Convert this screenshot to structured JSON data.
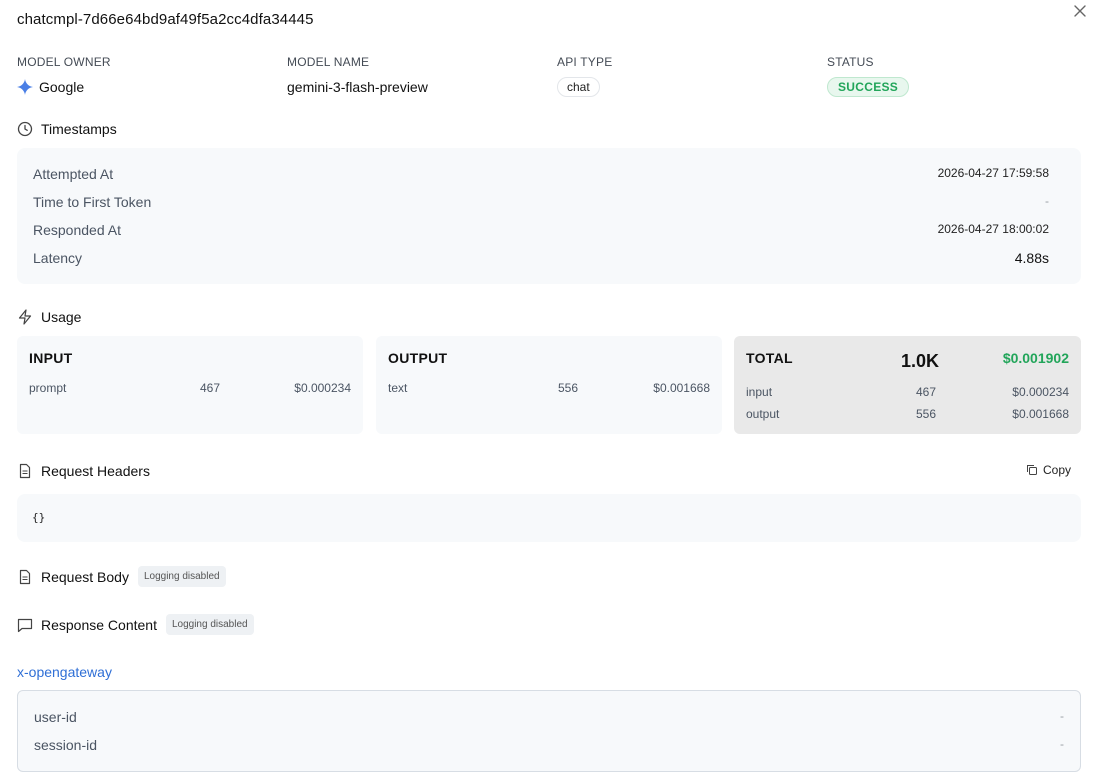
{
  "title": "chatcmpl-7d66e64bd9af49f5a2cc4dfa34445",
  "meta": {
    "owner_label": "MODEL OWNER",
    "owner_value": "Google",
    "name_label": "MODEL NAME",
    "name_value": "gemini-3-flash-preview",
    "api_label": "API TYPE",
    "api_value": "chat",
    "status_label": "STATUS",
    "status_value": "SUCCESS"
  },
  "timestamps": {
    "heading": "Timestamps",
    "rows": [
      {
        "label": "Attempted At",
        "value": "2026-04-27 17:59:58"
      },
      {
        "label": "Time to First Token",
        "value": "-"
      },
      {
        "label": "Responded At",
        "value": "2026-04-27 18:00:02"
      },
      {
        "label": "Latency",
        "value": "4.88s"
      }
    ]
  },
  "usage": {
    "heading": "Usage",
    "input": {
      "title": "INPUT",
      "label": "prompt",
      "count": "467",
      "cost": "$0.000234"
    },
    "output": {
      "title": "OUTPUT",
      "label": "text",
      "count": "556",
      "cost": "$0.001668"
    },
    "total": {
      "title": "TOTAL",
      "tokens": "1.0K",
      "cost": "$0.001902",
      "rows": [
        {
          "label": "input",
          "count": "467",
          "cost": "$0.000234"
        },
        {
          "label": "output",
          "count": "556",
          "cost": "$0.001668"
        }
      ]
    }
  },
  "request_headers": {
    "heading": "Request Headers",
    "copy_label": "Copy",
    "content": "{}"
  },
  "request_body": {
    "heading": "Request Body",
    "badge": "Logging disabled"
  },
  "response_content": {
    "heading": "Response Content",
    "badge": "Logging disabled"
  },
  "gateway": {
    "link": "x-opengateway",
    "rows": [
      {
        "label": "user-id",
        "value": "-"
      },
      {
        "label": "session-id",
        "value": "-"
      }
    ]
  },
  "colors": {
    "accent": "#2f6fd6",
    "success": "#22a55a",
    "panel": "#f7f9fb"
  }
}
